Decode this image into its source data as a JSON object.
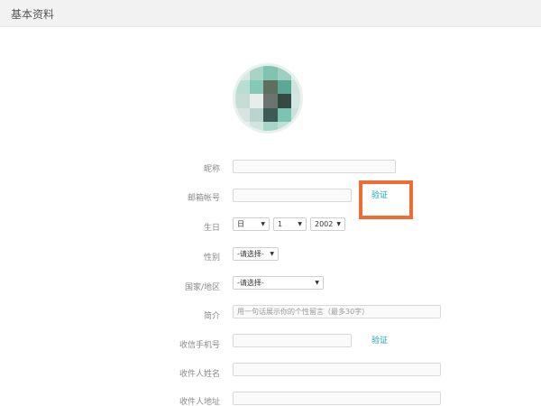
{
  "header": {
    "title": "基本资料"
  },
  "colors": {
    "accent": "#1aa3b5",
    "highlight": "#ef6d33"
  },
  "form": {
    "nickname": {
      "label": "昵称",
      "value": ""
    },
    "email": {
      "label": "邮箱帐号",
      "value": "",
      "verify_label": "验证"
    },
    "birthday": {
      "label": "生日",
      "day": "日",
      "month": "1",
      "year": "2002"
    },
    "gender": {
      "label": "性别",
      "value": "-请选择-"
    },
    "region": {
      "label": "国家/地区",
      "value": "-请选择-"
    },
    "bio": {
      "label": "简介",
      "placeholder": "用一句话展示你的个性留言（最多30字）"
    },
    "phone": {
      "label": "收信手机号",
      "value": "",
      "verify_label": "验证"
    },
    "recipient_name": {
      "label": "收件人姓名",
      "value": ""
    },
    "recipient_address": {
      "label": "收件人地址",
      "value": ""
    }
  }
}
